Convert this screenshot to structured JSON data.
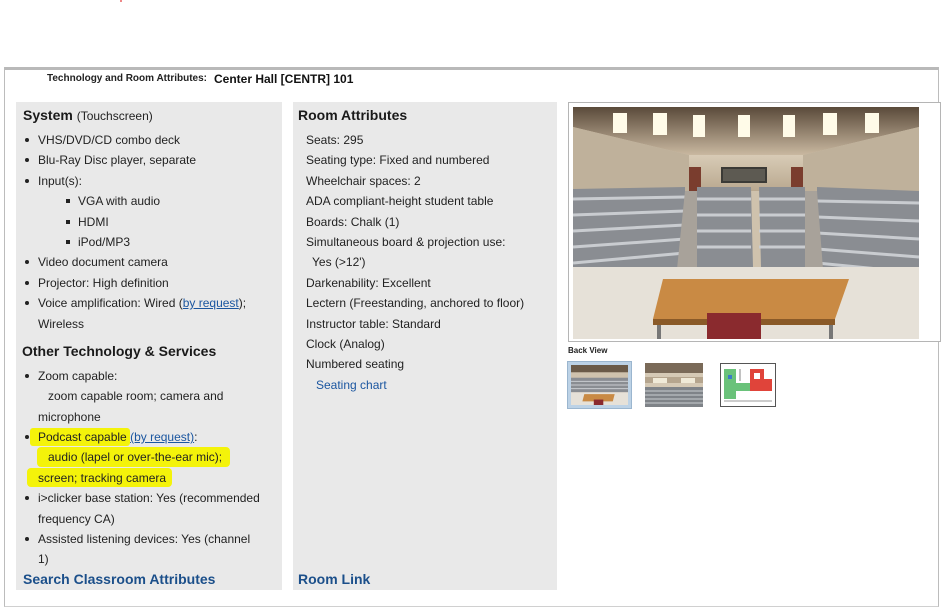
{
  "header": {
    "label": "Technology and Room Attributes:",
    "room": "Center Hall [CENTR]  101"
  },
  "system": {
    "title": "System",
    "subtitle": "(Touchscreen)",
    "items": {
      "vhs": "VHS/DVD/CD combo deck",
      "bluray": "Blu-Ray Disc player, separate",
      "inputs": "Input(s):",
      "vga": "VGA with audio",
      "hdmi": "HDMI",
      "ipod": "iPod/MP3",
      "doccam": "Video document camera",
      "projector": "Projector: High definition",
      "voice_prefix": "Voice amplification: Wired (",
      "voice_link": "by request",
      "voice_suffix": ");",
      "voice_line2": "Wireless"
    }
  },
  "other": {
    "title": "Other Technology & Services",
    "zoom_label": "Zoom capable:",
    "zoom_line2": "zoom capable room; camera and",
    "zoom_line3": "microphone",
    "podcast_label": "Podcast capable",
    "podcast_link": "(by request)",
    "podcast_colon": ":",
    "podcast_line2": "audio (lapel or over-the-ear mic);",
    "podcast_line3": "screen; tracking camera",
    "iclicker_line1": "i>clicker base station: Yes (recommended",
    "iclicker_line2": "frequency CA)",
    "assisted_line1": "Assisted listening devices: Yes (channel",
    "assisted_line2": "1)",
    "search_link": "Search Classroom Attributes"
  },
  "attributes": {
    "title": "Room Attributes",
    "seats": "Seats: 295",
    "seating_type": "Seating type: Fixed and numbered",
    "wheelchair": "Wheelchair spaces: 2",
    "ada": "ADA compliant-height student table",
    "boards": "Boards: Chalk (1)",
    "simultaneous": "Simultaneous board & projection use:",
    "simultaneous_val": "Yes (>12')",
    "darken": "Darkenability: Excellent",
    "lectern": "Lectern (Freestanding, anchored to floor)",
    "instructor": "Instructor table: Standard",
    "clock": "Clock (Analog)",
    "numbered": "Numbered seating",
    "seating_chart": "Seating chart",
    "room_link": "Room Link"
  },
  "gallery": {
    "caption": "Back View"
  },
  "colors": {
    "link": "#1b56a0",
    "highlight": "#f4f30a",
    "panel": "#e9e9e9"
  }
}
